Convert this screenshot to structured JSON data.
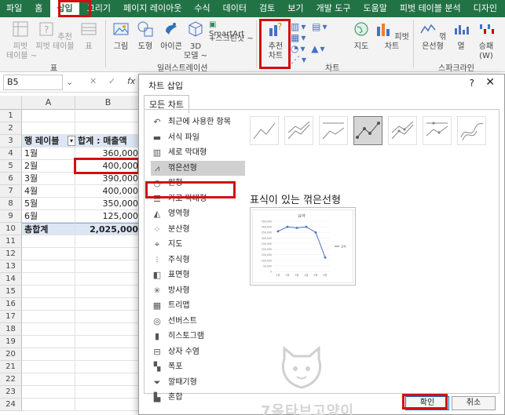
{
  "ribbon": {
    "tabs": [
      "파일",
      "홈",
      "삽입",
      "그리기",
      "페이지 레이아웃",
      "수식",
      "데이터",
      "검토",
      "보기",
      "개발 도구",
      "도움말",
      "피벗 테이블 분석",
      "디자인"
    ],
    "active_tab": "삽입",
    "tables_group": {
      "label": "표",
      "pivot": "피벗\n테이블 ~",
      "recommended_pivot": "추천\n피벗 테이블",
      "table": "표"
    },
    "illustrations_group": {
      "label": "일러스트레이션",
      "picture": "그림",
      "shapes": "도형",
      "icons": "아이콘",
      "model_3d": "3D\n모델 ~",
      "smartart": "SmartArt",
      "screenshot": "+스크린샷 ~"
    },
    "charts_group": {
      "label": "차트",
      "recommended": "추천\n차트",
      "maps": "지도",
      "pivot_chart": "피벗 차트"
    },
    "sparklines_group": {
      "label": "스파크라인",
      "line": "꺾은선형",
      "column": "열",
      "winloss": "승패\n(W)"
    }
  },
  "formula_bar": {
    "name_box": "B5",
    "fx": "fx"
  },
  "sheet": {
    "columns": [
      "A",
      "B"
    ],
    "rows": [
      "1",
      "2",
      "3",
      "4",
      "5",
      "6",
      "7",
      "8",
      "9",
      "10",
      "11",
      "12",
      "13",
      "14",
      "15",
      "16",
      "17",
      "18",
      "19",
      "20",
      "21",
      "22",
      "23",
      "24"
    ],
    "header": {
      "a": "행 레이블",
      "b": "합계 : 매출액"
    },
    "data": [
      {
        "a": "1월",
        "b": "360,000"
      },
      {
        "a": "2월",
        "b": "400,000"
      },
      {
        "a": "3월",
        "b": "390,000"
      },
      {
        "a": "4월",
        "b": "400,000"
      },
      {
        "a": "5월",
        "b": "350,000"
      },
      {
        "a": "6월",
        "b": "125,000"
      }
    ],
    "total": {
      "a": "총합계",
      "b": "2,025,000"
    }
  },
  "dialog": {
    "title": "차트 삽입",
    "help": "?",
    "close": "✕",
    "tab": "모든 차트",
    "categories": [
      {
        "label": "최근에 사용한 항목",
        "icon": "undo-icon"
      },
      {
        "label": "서식 파일",
        "icon": "folder-icon"
      },
      {
        "label": "세로 막대형",
        "icon": "column-chart-icon"
      },
      {
        "label": "꺾은선형",
        "icon": "line-chart-icon"
      },
      {
        "label": "원형",
        "icon": "pie-chart-icon"
      },
      {
        "label": "가로 막대형",
        "icon": "bar-chart-icon"
      },
      {
        "label": "영역형",
        "icon": "area-chart-icon"
      },
      {
        "label": "분산형",
        "icon": "scatter-chart-icon"
      },
      {
        "label": "지도",
        "icon": "map-icon"
      },
      {
        "label": "주식형",
        "icon": "stock-chart-icon"
      },
      {
        "label": "표면형",
        "icon": "surface-chart-icon"
      },
      {
        "label": "방사형",
        "icon": "radar-chart-icon"
      },
      {
        "label": "트리맵",
        "icon": "treemap-icon"
      },
      {
        "label": "선버스트",
        "icon": "sunburst-icon"
      },
      {
        "label": "히스토그램",
        "icon": "histogram-icon"
      },
      {
        "label": "상자 수염",
        "icon": "box-whisker-icon"
      },
      {
        "label": "폭포",
        "icon": "waterfall-icon"
      },
      {
        "label": "깔때기형",
        "icon": "funnel-icon"
      },
      {
        "label": "혼합",
        "icon": "combo-chart-icon"
      }
    ],
    "selected_category": "꺾은선형",
    "subtype_title": "표식이 있는 꺾은선형",
    "ok": "확인",
    "cancel": "취소"
  },
  "watermark": {
    "text": "7옥타브고양이"
  },
  "chart_data": {
    "type": "line",
    "title": "요약",
    "categories": [
      "1월",
      "2월",
      "3월",
      "4월",
      "5월",
      "6월"
    ],
    "series": [
      {
        "name": "요약",
        "values": [
          360000,
          400000,
          390000,
          400000,
          350000,
          125000
        ]
      }
    ],
    "ylim": [
      0,
      450000
    ],
    "yticks": [
      "0",
      "50,000",
      "100,000",
      "150,000",
      "200,000",
      "250,000",
      "300,000",
      "350,000",
      "400,000",
      "450,000"
    ],
    "legend": "right",
    "markers": true
  },
  "colors": {
    "excel_green": "#217346",
    "highlight_red": "#d01010",
    "series_blue": "#4472c4",
    "pivot_header": "#dde6f4"
  }
}
